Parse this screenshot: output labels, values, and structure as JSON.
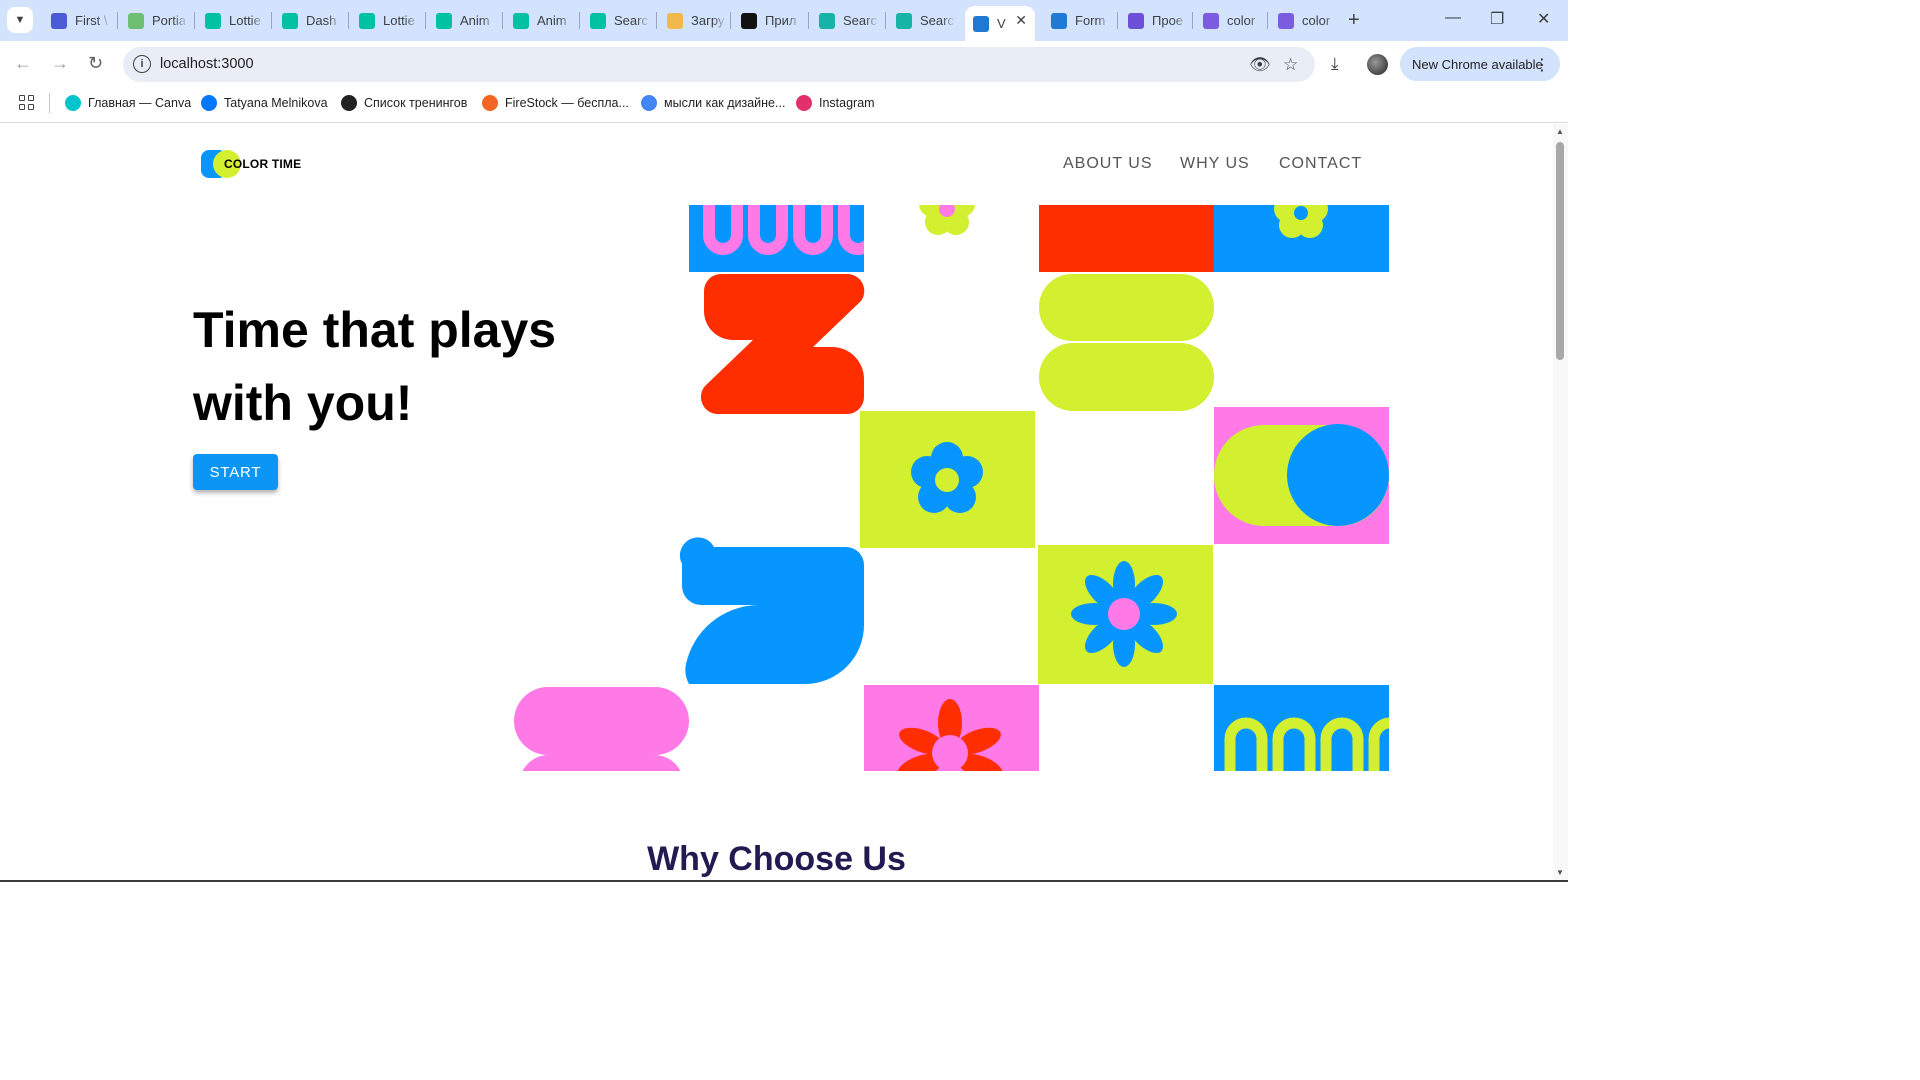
{
  "browser": {
    "tabs": [
      {
        "title": "First \\",
        "icon_color": "#4b5bd6",
        "icon_glyph": ""
      },
      {
        "title": "Portia",
        "icon_color": "#6fbf73",
        "icon_glyph": ""
      },
      {
        "title": "Lottie",
        "icon_color": "#00c1a2",
        "icon_glyph": ""
      },
      {
        "title": "Dash",
        "icon_color": "#00c1a2",
        "icon_glyph": ""
      },
      {
        "title": "Lottie",
        "icon_color": "#00c1a2",
        "icon_glyph": ""
      },
      {
        "title": "Anim",
        "icon_color": "#00c1a2",
        "icon_glyph": ""
      },
      {
        "title": "Anim",
        "icon_color": "#00c1a2",
        "icon_glyph": ""
      },
      {
        "title": "Searc",
        "icon_color": "#00c1a2",
        "icon_glyph": ""
      },
      {
        "title": "Загру",
        "icon_color": "#f1b94b",
        "icon_glyph": ""
      },
      {
        "title": "Прил",
        "icon_color": "#111111",
        "icon_glyph": ""
      },
      {
        "title": "Searc",
        "icon_color": "#16b3a7",
        "icon_glyph": ""
      },
      {
        "title": "Searc",
        "icon_color": "#16b3a7",
        "icon_glyph": ""
      },
      {
        "title": "V",
        "icon_color": "#1f78d1",
        "icon_glyph": "",
        "active": true
      },
      {
        "title": "Form",
        "icon_color": "#1f78d1",
        "icon_glyph": ""
      },
      {
        "title": "Прое",
        "icon_color": "#6b4fd8",
        "icon_glyph": ""
      },
      {
        "title": "color",
        "icon_color": "#7b5ce0",
        "icon_glyph": ""
      },
      {
        "title": "color",
        "icon_color": "#7b5ce0",
        "icon_glyph": ""
      }
    ],
    "url": "localhost:3000",
    "update_label": "New Chrome available",
    "bookmarks": [
      {
        "label": "Главная — Canva",
        "icon_color": "#00c4cc"
      },
      {
        "label": "Tatyana Melnikova",
        "icon_color": "#0077ff"
      },
      {
        "label": "Список тренингов",
        "icon_color": "#222222"
      },
      {
        "label": "FireStock — бесплa...",
        "icon_color": "#f26522"
      },
      {
        "label": "мысли как дизайне...",
        "icon_color": "#4285f4"
      },
      {
        "label": "Instagram",
        "icon_color": "#e1306c"
      }
    ]
  },
  "site": {
    "logo_text": "COLOR TIME",
    "nav": [
      "ABOUT US",
      "WHY US",
      "CONTACT"
    ],
    "hero_line1": "Time that plays",
    "hero_line2": "with you!",
    "start_label": "START",
    "section_title": "Why Choose Us"
  },
  "colors": {
    "blue": "#0796ff",
    "lime": "#d2ef30",
    "red": "#ff2e00",
    "pink": "#ff7ae6",
    "title_dark": "#241a52",
    "button_blue": "#0b96f5"
  }
}
